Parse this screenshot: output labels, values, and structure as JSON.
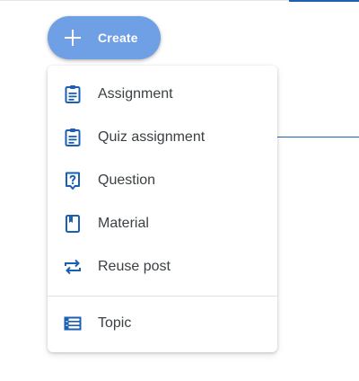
{
  "create_button": {
    "label": "Create",
    "icon": "plus-icon",
    "color": "#6f9fe4"
  },
  "menu": {
    "items": [
      {
        "label": "Assignment",
        "icon": "assignment-icon"
      },
      {
        "label": "Quiz assignment",
        "icon": "quiz-assignment-icon"
      },
      {
        "label": "Question",
        "icon": "question-icon"
      },
      {
        "label": "Material",
        "icon": "material-icon"
      },
      {
        "label": "Reuse post",
        "icon": "reuse-post-icon"
      },
      {
        "label": "Topic",
        "icon": "topic-icon"
      }
    ]
  },
  "colors": {
    "icon_blue": "#1a5fb4",
    "text": "#3c4043",
    "accent_line": "#1f5fb0"
  }
}
